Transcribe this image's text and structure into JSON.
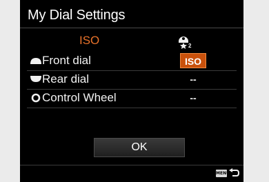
{
  "screen": {
    "title": "My Dial Settings",
    "column_header": "ISO",
    "custom_icon": "custom-star-2-icon",
    "rows": [
      {
        "icon": "front-dial-icon",
        "label": "Front dial",
        "value": "ISO",
        "selected": true
      },
      {
        "icon": "rear-dial-icon",
        "label": "Rear dial",
        "value": "--",
        "selected": false
      },
      {
        "icon": "control-wheel-icon",
        "label": "Control Wheel",
        "value": "--",
        "selected": false
      }
    ],
    "ok_label": "OK",
    "menu_badge": "MENU",
    "back_icon": "back-arrow-icon"
  },
  "colors": {
    "accent": "#e8722a",
    "selected_bg": "#c9510c",
    "background": "#000000"
  }
}
